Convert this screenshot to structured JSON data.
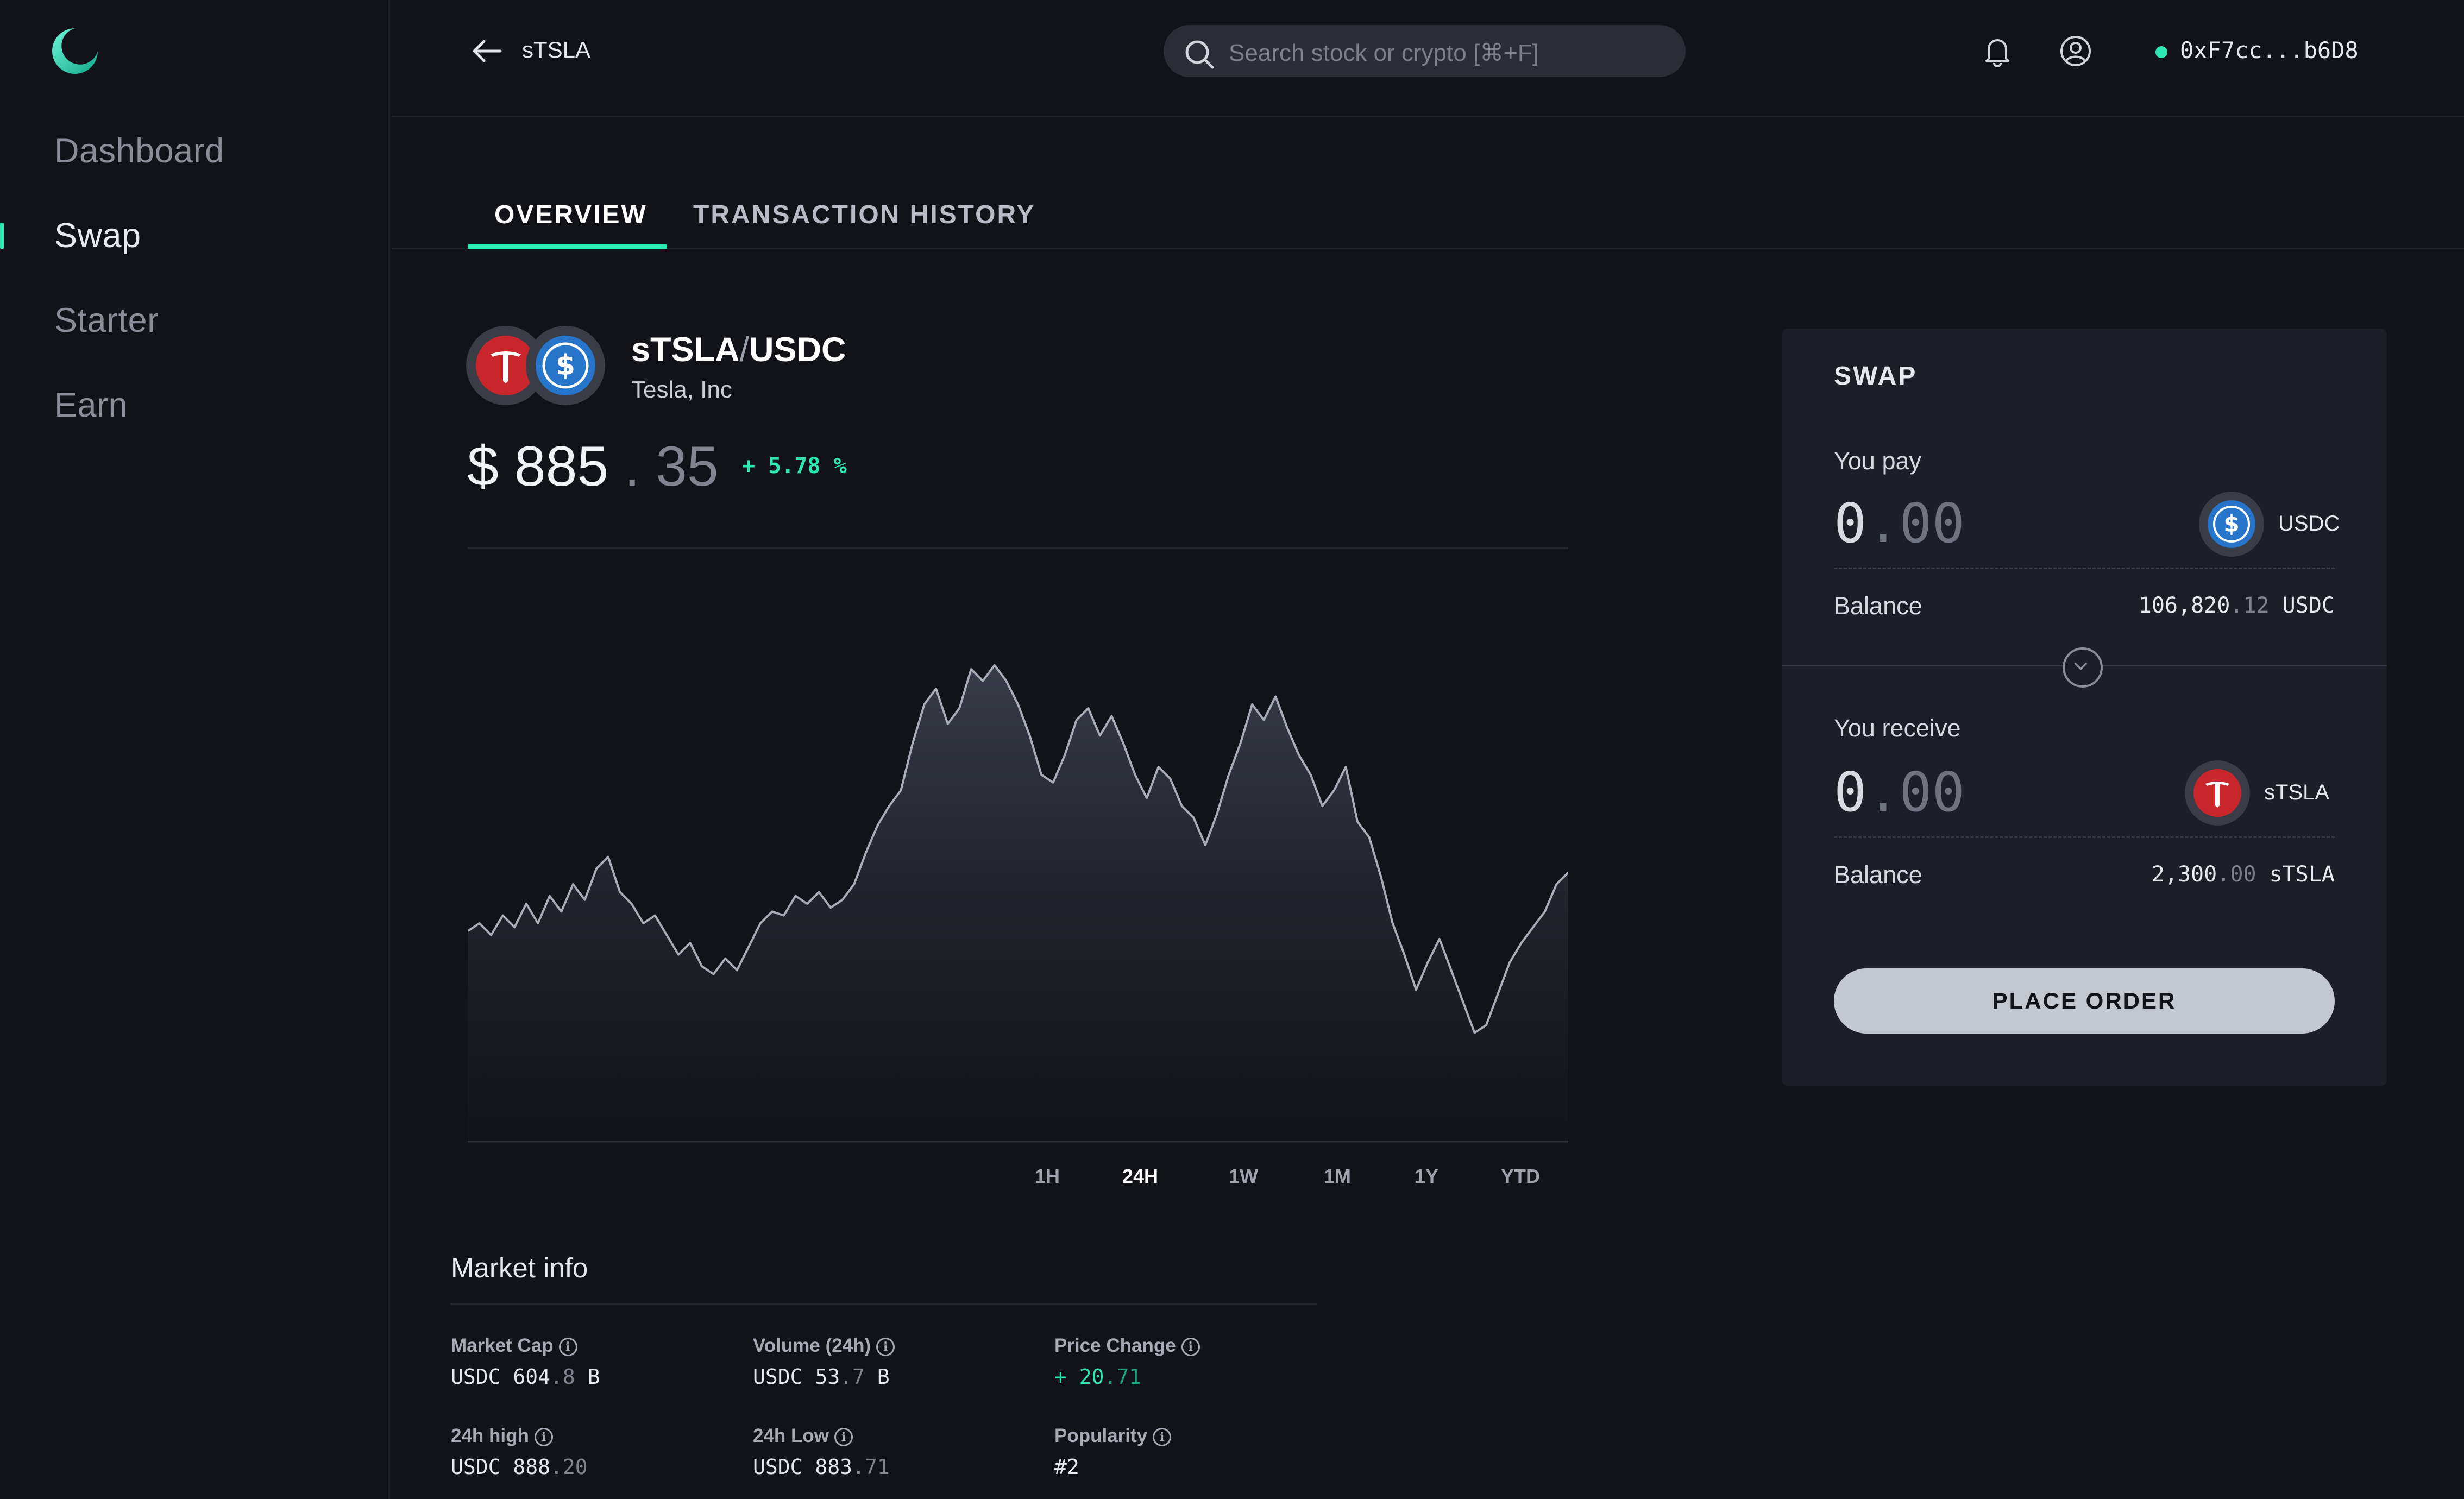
{
  "sidebar": {
    "items": [
      {
        "label": "Dashboard"
      },
      {
        "label": "Swap"
      },
      {
        "label": "Starter"
      },
      {
        "label": "Earn"
      }
    ],
    "active": "Swap"
  },
  "header": {
    "title": "sTSLA",
    "search_placeholder": "Search stock or crypto [⌘+F]",
    "wallet_address": "0xF7cc...b6D8",
    "wallet_status_color": "#2ee8b4"
  },
  "tabs": [
    {
      "label": "OVERVIEW",
      "active": true
    },
    {
      "label": "TRANSACTION HISTORY",
      "active": false
    }
  ],
  "pair": {
    "base": "sTSLA",
    "separator": "/",
    "quote": "USDC",
    "company": "Tesla, Inc",
    "price_currency": "$",
    "price_int": "885",
    "price_sep": ".",
    "price_dec": "35",
    "change": "+ 5.78 %"
  },
  "chart_data": {
    "type": "area",
    "selected_range": "24H",
    "ranges": [
      "1H",
      "24H",
      "1W",
      "1M",
      "1Y",
      "YTD"
    ],
    "values": [
      0.48,
      0.5,
      0.47,
      0.52,
      0.49,
      0.55,
      0.5,
      0.57,
      0.53,
      0.6,
      0.56,
      0.64,
      0.67,
      0.58,
      0.55,
      0.5,
      0.52,
      0.47,
      0.42,
      0.45,
      0.39,
      0.37,
      0.41,
      0.38,
      0.44,
      0.5,
      0.53,
      0.52,
      0.57,
      0.55,
      0.58,
      0.54,
      0.56,
      0.6,
      0.68,
      0.75,
      0.8,
      0.84,
      0.96,
      1.06,
      1.1,
      1.01,
      1.05,
      1.15,
      1.12,
      1.16,
      1.12,
      1.06,
      0.98,
      0.88,
      0.86,
      0.93,
      1.02,
      1.05,
      0.98,
      1.03,
      0.96,
      0.88,
      0.82,
      0.9,
      0.87,
      0.8,
      0.77,
      0.7,
      0.78,
      0.88,
      0.96,
      1.06,
      1.02,
      1.08,
      1.0,
      0.93,
      0.88,
      0.8,
      0.84,
      0.9,
      0.76,
      0.72,
      0.62,
      0.5,
      0.42,
      0.33,
      0.4,
      0.46,
      0.38,
      0.3,
      0.22,
      0.24,
      0.32,
      0.4,
      0.45,
      0.49,
      0.53,
      0.6,
      0.63
    ]
  },
  "market_info": {
    "title": "Market info",
    "items": [
      {
        "label": "Market Cap",
        "prefix": "USDC",
        "int": "604",
        "sep": ".",
        "dec": "8",
        "suffix": "B",
        "green": false
      },
      {
        "label": "Volume (24h)",
        "prefix": "USDC",
        "int": "53",
        "sep": ".",
        "dec": "7",
        "suffix": "B",
        "green": false
      },
      {
        "label": "Price Change",
        "prefix": "+",
        "int": "20",
        "sep": ".",
        "dec": "71",
        "suffix": "",
        "green": true
      },
      {
        "label": "24h high",
        "prefix": "USDC",
        "int": "888",
        "sep": ".",
        "dec": "20",
        "suffix": "",
        "green": false
      },
      {
        "label": "24h Low",
        "prefix": "USDC",
        "int": "883",
        "sep": ".",
        "dec": "71",
        "suffix": "",
        "green": false
      },
      {
        "label": "Popularity",
        "prefix": "",
        "int": "#2",
        "sep": "",
        "dec": "",
        "suffix": "",
        "green": false
      }
    ]
  },
  "swap": {
    "title": "SWAP",
    "pay_label": "You pay",
    "pay_amount_int": "0",
    "pay_amount_dec": ".00",
    "pay_token": "USDC",
    "pay_balance_label": "Balance",
    "pay_balance_int": "106,820",
    "pay_balance_dec": ".12",
    "pay_balance_unit": "USDC",
    "receive_label": "You receive",
    "receive_amount_int": "0",
    "receive_amount_dec": ".00",
    "receive_token": "sTSLA",
    "receive_balance_label": "Balance",
    "receive_balance_int": "2,300",
    "receive_balance_dec": ".00",
    "receive_balance_unit": "sTSLA",
    "order_button": "PLACE ORDER"
  },
  "icons": {
    "logo": "logo-icon",
    "back": "arrow-left-icon",
    "search": "search-icon",
    "bell": "bell-icon",
    "user": "user-circle-icon",
    "swap_toggle": "chevron-down-icon",
    "info": "info-icon",
    "tesla": "tesla-icon",
    "usdc": "usdc-icon"
  },
  "colors": {
    "accent": "#2ee8b4",
    "background": "#111319",
    "panel": "#1c1f28",
    "tesla_red": "#c8262b",
    "usdc_blue": "#2775ca"
  }
}
